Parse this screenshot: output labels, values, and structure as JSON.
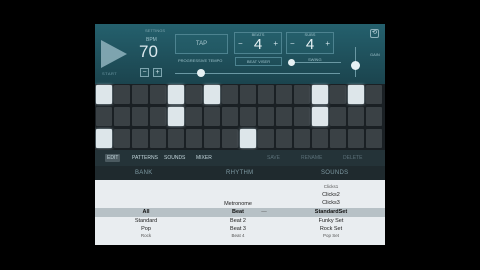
{
  "header": {
    "start_label": "START",
    "settings_label": "SETTINGS",
    "bpm_label": "BPM",
    "bpm_value": "70",
    "bpm_minus": "−",
    "bpm_plus": "+",
    "tap_label": "TAP",
    "progressive_tempo_label": "PROGRESSIVE TEMPO",
    "beats_label": "BEATS",
    "beats_value": "4",
    "subs_label": "SUBS",
    "subs_value": "4",
    "counter_minus": "−",
    "counter_plus": "+",
    "beat_visual_label": "BEAT VISER",
    "swing_label": "SWING",
    "volume_icon": "⟲",
    "volume_label": "GAIN",
    "tempo_progress": 0.15,
    "swing_progress": 0.0,
    "volume_level": 0.55
  },
  "grid": {
    "rows": [
      [
        1,
        0,
        0,
        0,
        1,
        0,
        1,
        0,
        0,
        0,
        0,
        0,
        1,
        0,
        1,
        0
      ],
      [
        0,
        0,
        0,
        0,
        1,
        0,
        0,
        0,
        0,
        0,
        0,
        0,
        1,
        0,
        0,
        0
      ],
      [
        1,
        0,
        0,
        0,
        0,
        0,
        0,
        0,
        1,
        0,
        0,
        0,
        0,
        0,
        0,
        0
      ]
    ]
  },
  "tabs": {
    "edit": "EDIT",
    "patterns": "PATTERNS",
    "sounds": "SOUNDS",
    "mixer": "MIXER",
    "save": "SAVE",
    "rename": "RENAME",
    "delete": "DELETE"
  },
  "columns": {
    "bank": "BANK",
    "rhythm": "RHYTHM",
    "sounds": "SOUNDS"
  },
  "bank": [
    "All",
    "Standard",
    "Pop",
    "Rock"
  ],
  "rhythm": [
    "Metronome",
    "Beat",
    "Beat 2",
    "Beat 3",
    "Beat 4"
  ],
  "sounds": [
    "Clicks1",
    "Clicks2",
    "Clicks3",
    "StandardSet",
    "Funky Set",
    "Rock Set",
    "Pop Set"
  ],
  "divider": "—",
  "colors": {
    "accent": "#24606d",
    "step_on": "#dde6ea",
    "step_off": "#3a4145"
  }
}
